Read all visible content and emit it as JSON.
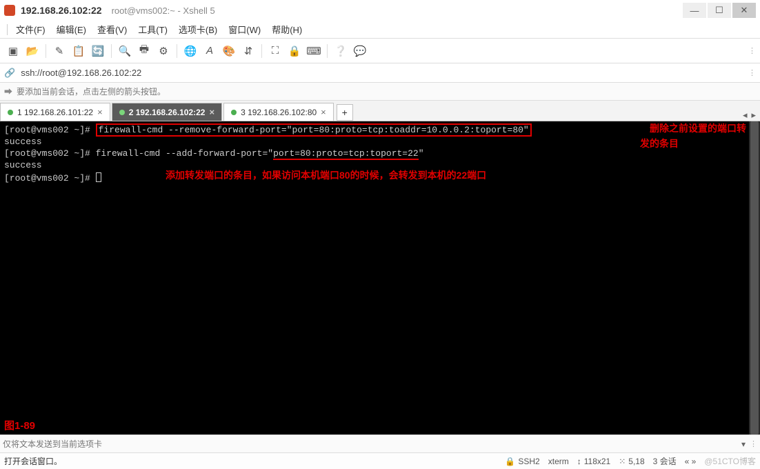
{
  "titlebar": {
    "host": "192.168.26.102:22",
    "subtitle": "root@vms002:~ - Xshell 5"
  },
  "menu": {
    "file": "文件(F)",
    "edit": "编辑(E)",
    "view": "查看(V)",
    "tools": "工具(T)",
    "tabs": "选项卡(B)",
    "window": "窗口(W)",
    "help": "帮助(H)"
  },
  "icons": {
    "new": "new-session-icon",
    "open": "open-folder-icon",
    "paste": "pencil-icon",
    "copyclip": "clipboard-icon",
    "refresh": "refresh-icon",
    "search": "search-icon",
    "print": "printer-icon",
    "props": "properties-icon",
    "globe": "globe-icon",
    "font": "font-icon",
    "palette": "color-palette-icon",
    "arrows": "scroll-arrows-icon",
    "fullscreen": "fullscreen-icon",
    "lock": "lock-icon",
    "keyboard": "keyboard-icon",
    "help": "help-icon",
    "bubble": "speech-bubble-icon"
  },
  "address": {
    "url": "ssh://root@192.168.26.102:22"
  },
  "hint": {
    "text": "要添加当前会话，点击左侧的箭头按钮。"
  },
  "tabs": [
    {
      "label": "1 192.168.26.101:22",
      "active": false
    },
    {
      "label": "2 192.168.26.102:22",
      "active": true
    },
    {
      "label": "3 192.168.26.102:80",
      "active": false
    }
  ],
  "terminal": {
    "prompt1": "[root@vms002 ~]# ",
    "cmd1": "firewall-cmd --remove-forward-port=\"port=80:proto=tcp:toaddr=10.0.0.2:toport=80\"",
    "out1": "success",
    "prompt2": "[root@vms002 ~]# ",
    "cmd2_a": "firewall-cmd --add-forward-port=\"",
    "cmd2_u": "port=80:proto=tcp:toport=22",
    "cmd2_b": "\"",
    "out2": "success",
    "prompt3": "[root@vms002 ~]# ",
    "anno1a": "删除之前设置的端口转",
    "anno1b": "发的条目",
    "anno2": "添加转发端口的条目，如果访问本机端口80的时候，会转发到本机的22端口",
    "figlabel": "图1-89"
  },
  "sendbar": {
    "placeholder": "仅将文本发送到当前选项卡"
  },
  "status": {
    "msg": "打开会话窗口。",
    "proto": "SSH2",
    "term": "xterm",
    "size": "118x21",
    "pos": "5,18",
    "sessions": "3 会话",
    "watermark": "@51CTO博客"
  }
}
